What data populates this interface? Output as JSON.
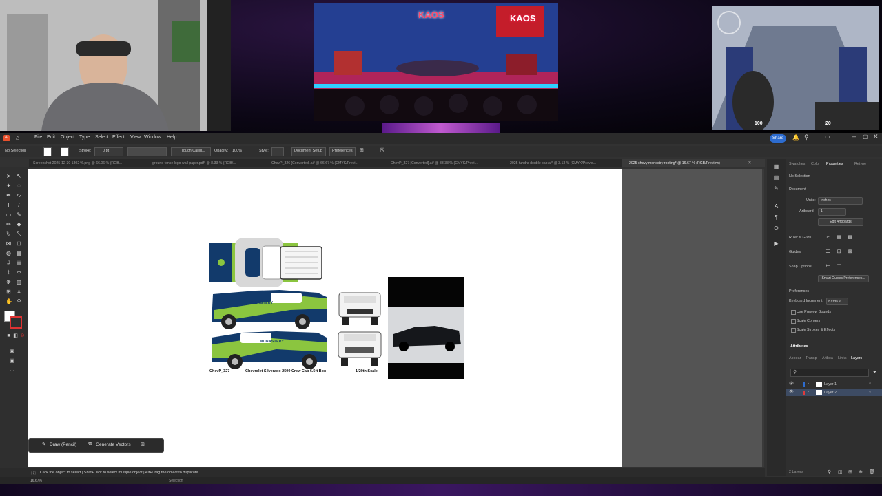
{
  "stream": {
    "studio_logo": "KAOS",
    "game_hud_left": "100",
    "game_hud_right": "20"
  },
  "app": {
    "menu": [
      "File",
      "Edit",
      "Object",
      "Type",
      "Select",
      "Effect",
      "View",
      "Window",
      "Help"
    ],
    "share_label": "Share"
  },
  "control": {
    "selection": "No Selection",
    "stroke_label": "Stroke:",
    "stroke_value": "0 pt",
    "brush": "Touch Callig...",
    "opacity_label": "Opacity:",
    "opacity_value": "100%",
    "style_label": "Style:",
    "document_setup": "Document Setup",
    "preferences": "Preferences"
  },
  "tabs": [
    "Screenshot 2025-12-30 130246.png @ 66.06 % (RGB...",
    "ground fence logo wall paper.pdf* @ 8.33 % (RGB/...",
    "ChevP_326 [Converted].ai* @ 66.67 % (CMYK/Previ...",
    "ChevP_327 [Converted].ai* @ 33.33 % (CMYK/Previ...",
    "2025 tundra double cab.ai* @ 3.13 % (CMYK/Previe...",
    "2025 chevy monestry roofing* @ 16.67 % (RGB/Preview)"
  ],
  "artwork": {
    "caption_left": "ChevP_327",
    "caption_mid": "Chevrolet Silverado 2500 Crew Cab 6.5ft Box",
    "caption_right": "1/20th Scale",
    "brand_text": "MONASTERY"
  },
  "float_bar": {
    "draw": "Draw (Pencil)",
    "generate": "Generate Vectors"
  },
  "status": {
    "hint": "Click the object to select  |  Shift+Click to select multiple object  |  Alt+Drag the object to duplicate",
    "zoom": "16.67%",
    "mode": "Selection"
  },
  "panel": {
    "tabs": [
      "Swatches",
      "Color",
      "Properties",
      "Retype"
    ],
    "no_selection": "No Selection",
    "document": "Document",
    "units_label": "Units:",
    "units_value": "Inches",
    "artboard_label": "Artboard:",
    "artboard_value": "1",
    "edit_artboards": "Edit Artboards",
    "ruler_grids": "Ruler & Grids",
    "guides": "Guides",
    "snap_options": "Snap Options",
    "smart_guides": "Smart Guides Preferences...",
    "preferences": "Preferences",
    "keyboard_increment": "Keyboard Increment:",
    "keyboard_value": "0.0139 in",
    "use_preview_bounds": "Use Preview Bounds",
    "scale_corners": "Scale Corners",
    "scale_strokes": "Scale Strokes & Effects",
    "attributes": "Attributes",
    "lower_tabs": [
      "Appear",
      "Transp",
      "Artboa",
      "Links",
      "Layers"
    ],
    "layers": [
      "Layer 1",
      "Layer 2"
    ],
    "layer_count": "2 Layers"
  },
  "colors": {
    "accent": "#2d6ccf",
    "wrap_navy": "#123a6b",
    "wrap_green": "#8bc53f"
  }
}
